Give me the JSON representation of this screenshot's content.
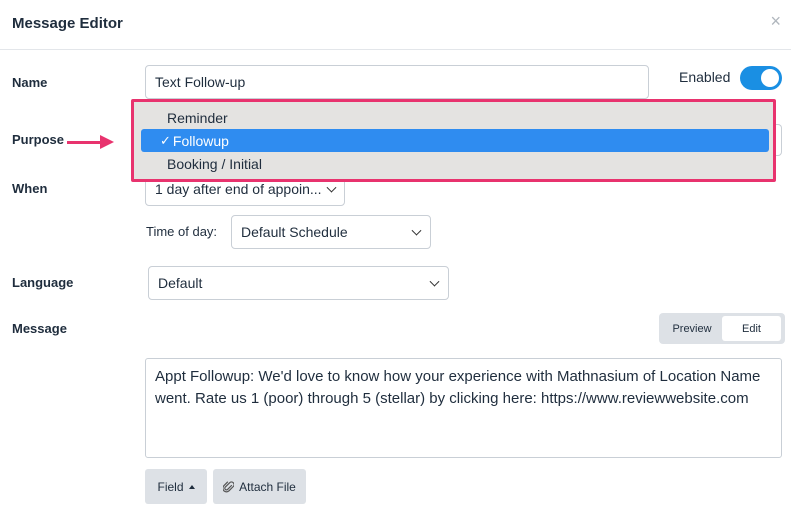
{
  "modal": {
    "title": "Message Editor",
    "close_glyph": "×"
  },
  "name_field": {
    "label": "Name",
    "value": "Text Follow-up"
  },
  "enabled": {
    "label": "Enabled",
    "on": true
  },
  "purpose": {
    "label": "Purpose",
    "options": [
      "Reminder",
      "Followup",
      "Booking / Initial"
    ],
    "selected": "Followup",
    "check_glyph": "✓"
  },
  "when": {
    "label": "When",
    "value": "1 day after end of appoin..."
  },
  "time_of_day": {
    "label": "Time of day:",
    "value": "Default Schedule"
  },
  "language": {
    "label": "Language",
    "value": "Default"
  },
  "message": {
    "label": "Message",
    "preview_label": "Preview",
    "edit_label": "Edit",
    "text": "Appt Followup: We'd love to know how your experience with Mathnasium of Location Name went. Rate us 1 (poor) through 5 (stellar) by clicking here: https://www.reviewwebsite.com"
  },
  "toolbar": {
    "field_label": "Field",
    "attach_label": "Attach File"
  },
  "colors": {
    "accent_blue": "#1a8fe3",
    "highlight_pink": "#e8336e",
    "selected_option": "#2f8cf0"
  }
}
